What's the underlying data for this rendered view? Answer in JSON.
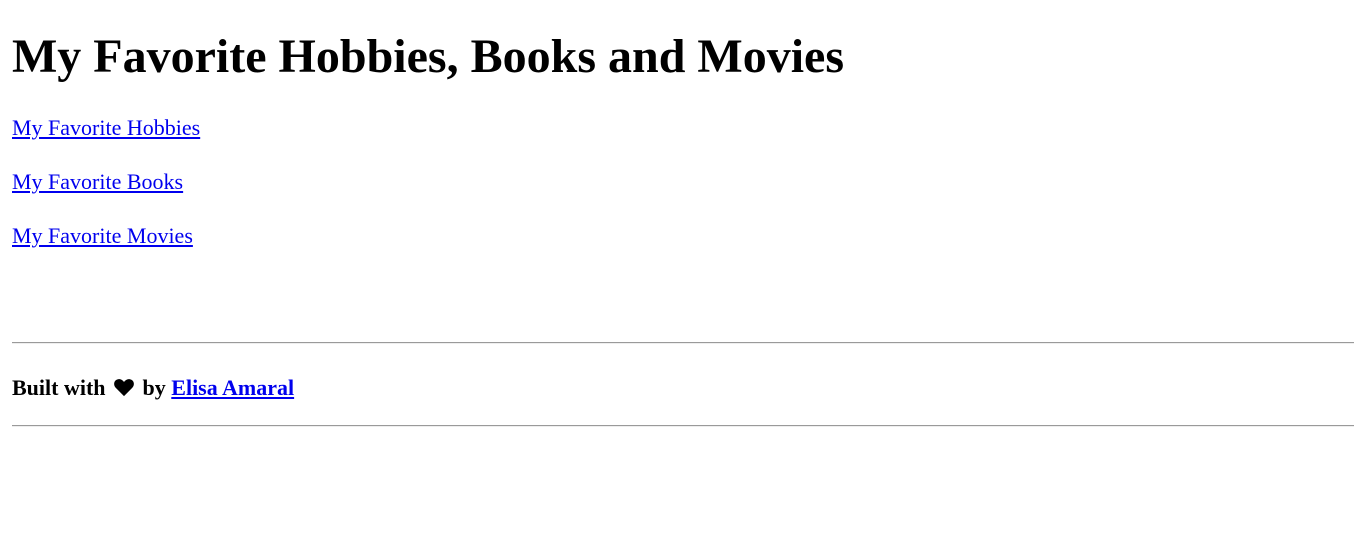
{
  "page": {
    "title": "My Favorite Hobbies, Books and Movies"
  },
  "nav": {
    "links": [
      {
        "label": "My Favorite Hobbies"
      },
      {
        "label": "My Favorite Books"
      },
      {
        "label": "My Favorite Movies"
      }
    ]
  },
  "footer": {
    "built_with": "Built with",
    "icon": "heart-icon",
    "by": "by",
    "author": "Elisa Amaral"
  },
  "colors": {
    "text": "#000000",
    "link": "#0000ee",
    "divider": "#9a9a9a",
    "background": "#ffffff"
  }
}
